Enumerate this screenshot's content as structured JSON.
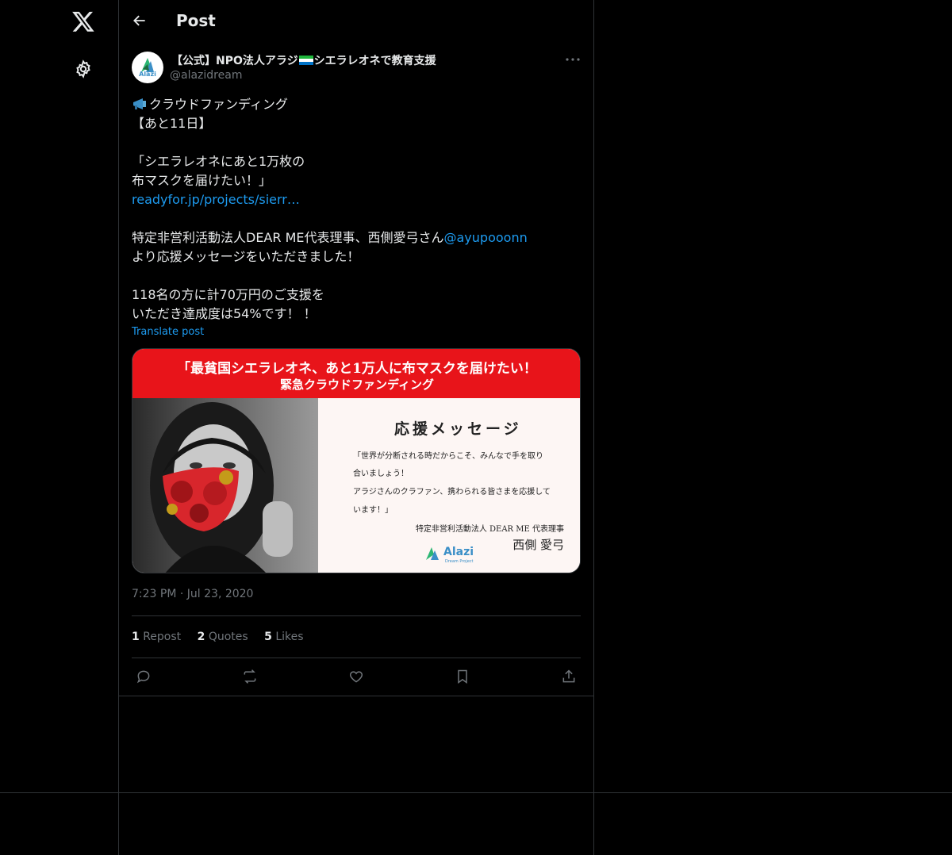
{
  "header": {
    "title": "Post"
  },
  "author": {
    "display_name_before": "【公式】NPO法人アラジ",
    "display_name_after": "シエラレオネで教育支援",
    "handle": "@alazidream",
    "avatar_text": "Alazi"
  },
  "post": {
    "lines": [
      {
        "text": "クラウドファンディング",
        "icon": "megaphone-emoji"
      },
      {
        "text": "【あと11日】"
      },
      {
        "text": ""
      },
      {
        "text": "「シエラレオネにあと1万枚の"
      },
      {
        "text": "布マスクを届けたい！」"
      },
      {
        "text": "readyfor.jp/projects/sierr…",
        "link": true
      },
      {
        "text": ""
      },
      {
        "text": "特定非営利活動法人DEAR ME代表理事、西側愛弓さん",
        "mention": "@ayupooonn"
      },
      {
        "text": "より応援メッセージをいただきました！"
      },
      {
        "text": ""
      },
      {
        "text": "118名の方に計70万円のご支援を"
      },
      {
        "text": "いただき達成度は54%です！ ！"
      }
    ],
    "translate_label": "Translate post"
  },
  "media": {
    "banner_line1": "「最貧国シエラレオネ、あと1万人に布マスクを届けたい！",
    "banner_line2": "緊急クラウドファンディング",
    "message_title": "応援メッセージ",
    "message_lines": [
      "「世界が分断される時だからこそ、みんなで手を取り",
      "合いましょう！",
      "アラジさんのクラファン、携わられる皆さまを応援して",
      "います！」"
    ],
    "org": "特定非営利活動法人 DEAR ME 代表理事",
    "name": "西側 愛弓",
    "logo_text": "Alazi",
    "logo_sub": "Dream Project"
  },
  "meta": {
    "time": "7:23 PM",
    "dot": "·",
    "date": "Jul 23, 2020"
  },
  "stats": {
    "reposts_count": "1",
    "reposts_label": "Repost",
    "quotes_count": "2",
    "quotes_label": "Quotes",
    "likes_count": "5",
    "likes_label": "Likes"
  },
  "colors": {
    "accent": "#1d9bf0",
    "banner_red": "#e8141a",
    "muted": "#71767b"
  }
}
